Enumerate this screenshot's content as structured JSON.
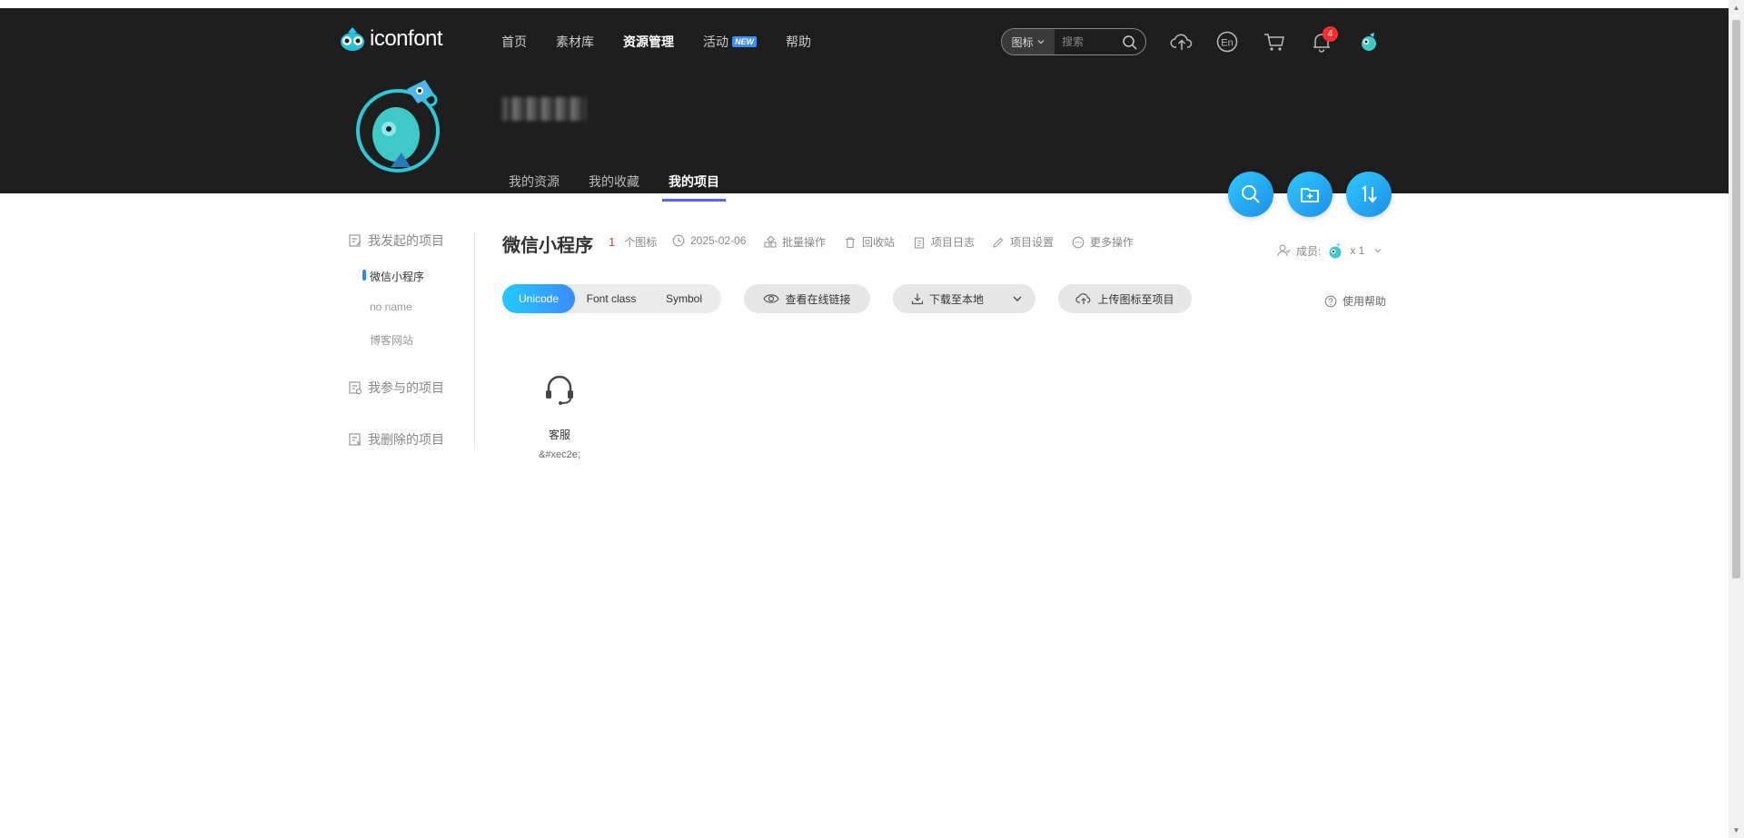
{
  "header": {
    "logo_text": "iconfont",
    "nav": [
      {
        "label": "首页"
      },
      {
        "label": "素材库"
      },
      {
        "label": "资源管理"
      },
      {
        "label": "活动"
      },
      {
        "label": "帮助"
      }
    ],
    "new_badge": "NEW",
    "search": {
      "type_label": "图标",
      "placeholder": "搜索"
    },
    "notification_count": "4"
  },
  "profile": {
    "tabs": [
      {
        "label": "我的资源"
      },
      {
        "label": "我的收藏"
      },
      {
        "label": "我的项目"
      }
    ]
  },
  "sidebar": {
    "started_label": "我发起的项目",
    "started_items": [
      {
        "label": "微信小程序"
      },
      {
        "label": "no name"
      },
      {
        "label": "博客网站"
      }
    ],
    "joined_label": "我参与的项目",
    "deleted_label": "我删除的项目"
  },
  "project": {
    "title": "微信小程序",
    "icon_count": "1",
    "icon_count_label": "个图标",
    "date": "2025-02-06",
    "actions": {
      "batch": "批量操作",
      "recycle": "回收站",
      "log": "项目日志",
      "settings": "项目设置",
      "more": "更多操作"
    },
    "members_label": "成员:",
    "members_count": "x 1"
  },
  "toolbar": {
    "tabs": [
      {
        "label": "Unicode"
      },
      {
        "label": "Font class"
      },
      {
        "label": "Symbol"
      }
    ],
    "view_link": "查看在线链接",
    "download": "下载至本地",
    "upload": "上传图标至项目",
    "help": "使用帮助"
  },
  "icons": [
    {
      "name": "客服",
      "code": "&#xec2e;",
      "icon": "headset-icon"
    }
  ],
  "colors": {
    "header_bg": "#1e1e1e",
    "accent": "#3d8bff",
    "tab_underline": "#5367ff",
    "badge_red": "#ff2d2d"
  }
}
